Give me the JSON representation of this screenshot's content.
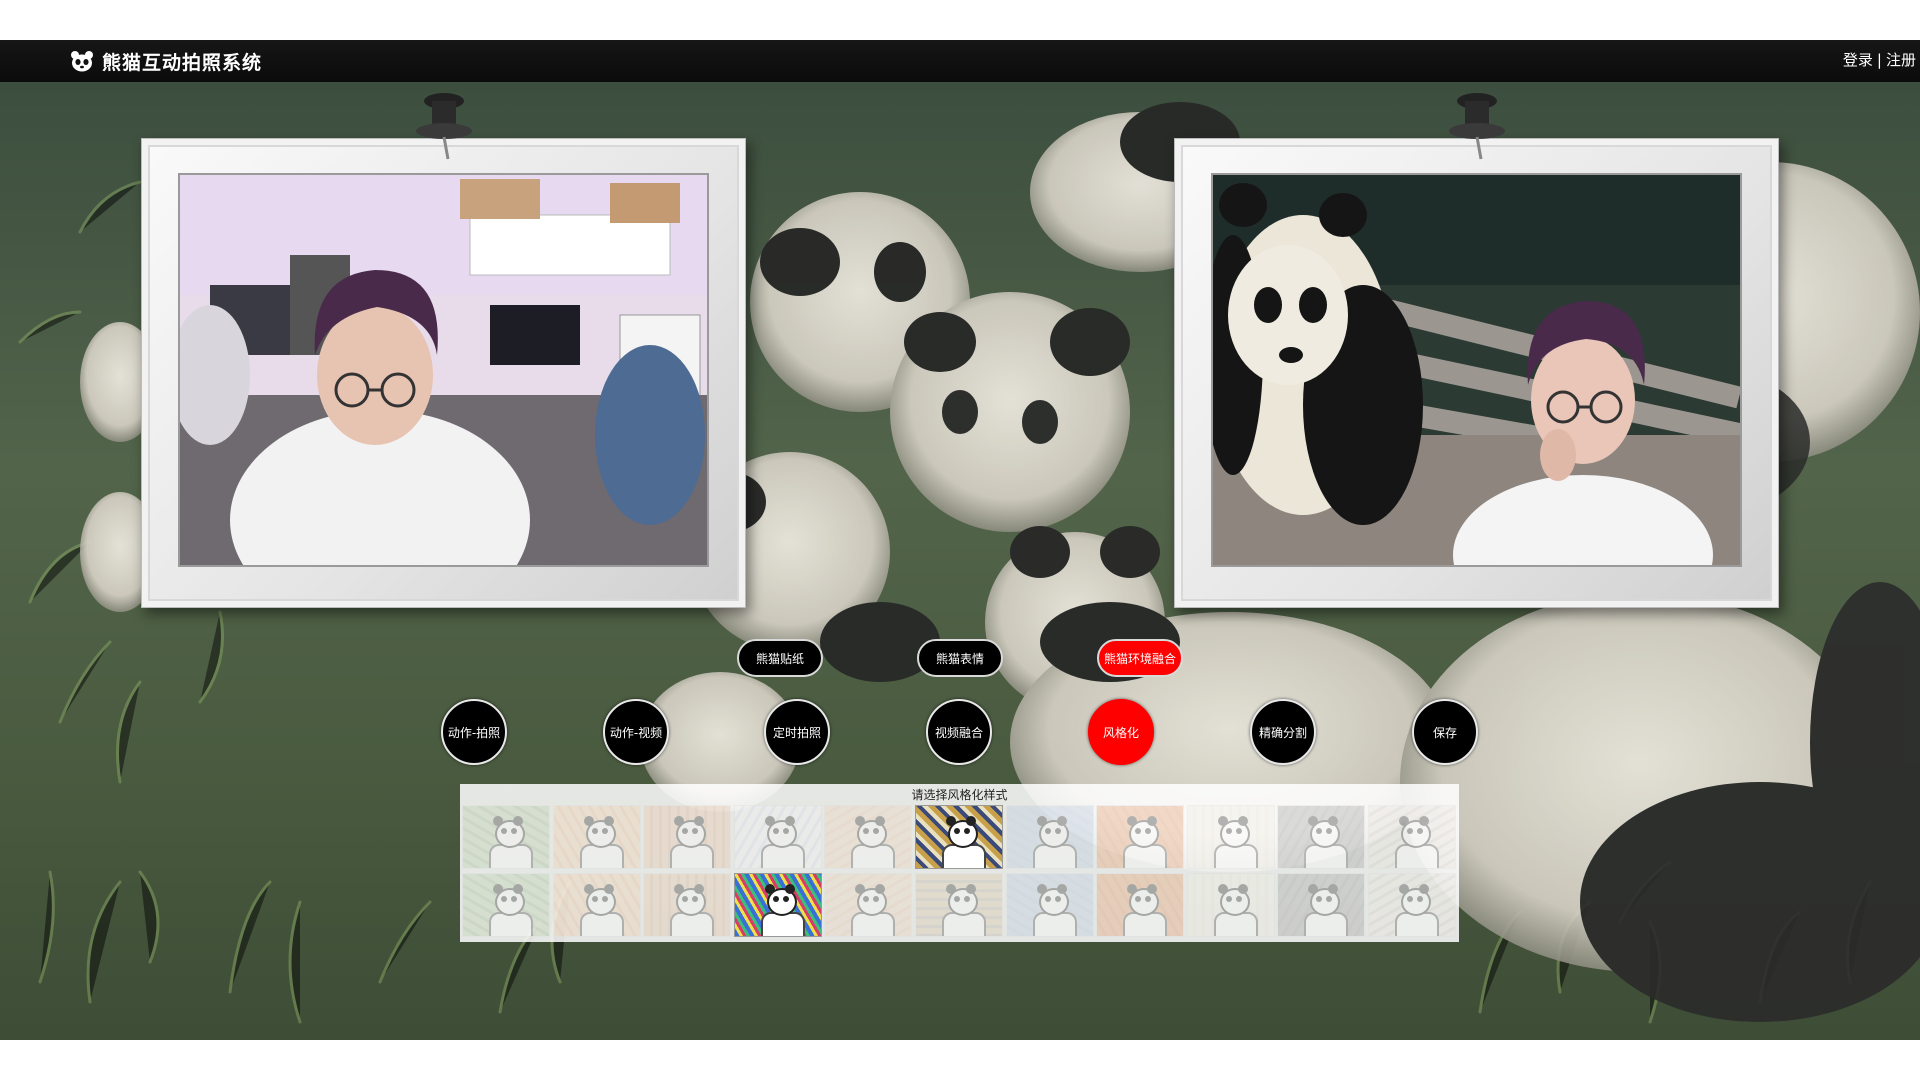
{
  "app": {
    "title": "熊猫互动拍照系统",
    "logo_icon": "panda-icon"
  },
  "auth": {
    "login": "登录",
    "separator": "|",
    "register": "注册"
  },
  "mode_buttons": [
    {
      "label": "熊猫贴纸",
      "active": false
    },
    {
      "label": "熊猫表情",
      "active": false
    },
    {
      "label": "熊猫环境融合",
      "active": true
    }
  ],
  "action_buttons": [
    {
      "label": "动作-拍照",
      "active": false
    },
    {
      "label": "动作-视频",
      "active": false
    },
    {
      "label": "定时拍照",
      "active": false
    },
    {
      "label": "视频融合",
      "active": false
    },
    {
      "label": "风格化",
      "active": true
    },
    {
      "label": "精确分割",
      "active": false
    },
    {
      "label": "保存",
      "active": false
    }
  ],
  "style_panel": {
    "title": "请选择风格化样式",
    "rows": 2,
    "columns": 11,
    "selected": [
      {
        "row": 1,
        "col": 6
      },
      {
        "row": 2,
        "col": 4
      }
    ]
  },
  "colors": {
    "accent_red": "#ff0000",
    "navbar": "#111111",
    "button_black": "#000000"
  }
}
